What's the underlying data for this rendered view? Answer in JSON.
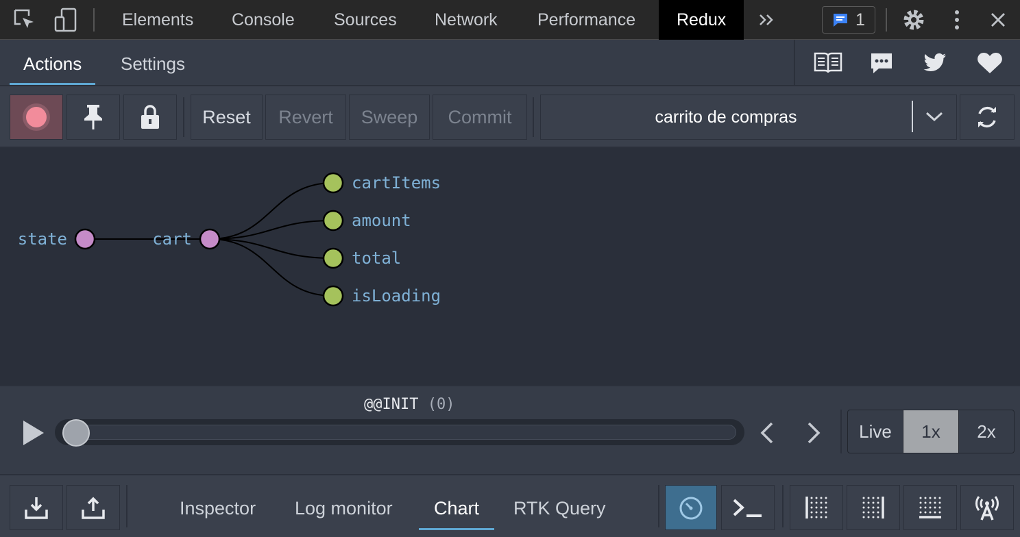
{
  "devtools": {
    "tabs": [
      "Elements",
      "Console",
      "Sources",
      "Network",
      "Performance",
      "Redux"
    ],
    "active_tab": "Redux",
    "issues_count": "1"
  },
  "redux": {
    "tabs": [
      "Actions",
      "Settings"
    ],
    "active_tab": "Actions",
    "toolbar": {
      "reset": "Reset",
      "revert": "Revert",
      "sweep": "Sweep",
      "commit": "Commit",
      "instance": "carrito de compras"
    },
    "tree": {
      "root": "state",
      "child": "cart",
      "leaves": [
        "cartItems",
        "amount",
        "total",
        "isLoading"
      ]
    },
    "slider": {
      "action_name": "@@INIT",
      "action_index": "(0)",
      "position": 0,
      "speeds": [
        "Live",
        "1x",
        "2x"
      ],
      "selected_speed": "1x"
    },
    "monitors": [
      "Inspector",
      "Log monitor",
      "Chart",
      "RTK Query"
    ],
    "active_monitor": "Chart"
  },
  "colors": {
    "accent": "#5fa8d3",
    "node_parent": "#c58bc8",
    "node_leaf": "#a5c25c",
    "record": "#f28c9b"
  }
}
